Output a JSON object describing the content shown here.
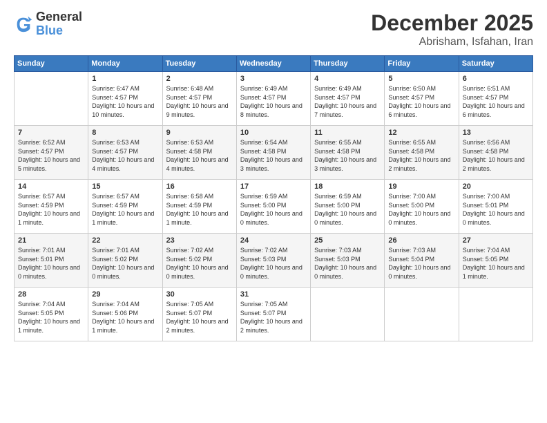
{
  "logo": {
    "line1": "General",
    "line2": "Blue"
  },
  "header": {
    "month": "December 2025",
    "location": "Abrisham, Isfahan, Iran"
  },
  "weekdays": [
    "Sunday",
    "Monday",
    "Tuesday",
    "Wednesday",
    "Thursday",
    "Friday",
    "Saturday"
  ],
  "weeks": [
    [
      {
        "day": "",
        "sunrise": "",
        "sunset": "",
        "daylight": ""
      },
      {
        "day": "1",
        "sunrise": "Sunrise: 6:47 AM",
        "sunset": "Sunset: 4:57 PM",
        "daylight": "Daylight: 10 hours and 10 minutes."
      },
      {
        "day": "2",
        "sunrise": "Sunrise: 6:48 AM",
        "sunset": "Sunset: 4:57 PM",
        "daylight": "Daylight: 10 hours and 9 minutes."
      },
      {
        "day": "3",
        "sunrise": "Sunrise: 6:49 AM",
        "sunset": "Sunset: 4:57 PM",
        "daylight": "Daylight: 10 hours and 8 minutes."
      },
      {
        "day": "4",
        "sunrise": "Sunrise: 6:49 AM",
        "sunset": "Sunset: 4:57 PM",
        "daylight": "Daylight: 10 hours and 7 minutes."
      },
      {
        "day": "5",
        "sunrise": "Sunrise: 6:50 AM",
        "sunset": "Sunset: 4:57 PM",
        "daylight": "Daylight: 10 hours and 6 minutes."
      },
      {
        "day": "6",
        "sunrise": "Sunrise: 6:51 AM",
        "sunset": "Sunset: 4:57 PM",
        "daylight": "Daylight: 10 hours and 6 minutes."
      }
    ],
    [
      {
        "day": "7",
        "sunrise": "Sunrise: 6:52 AM",
        "sunset": "Sunset: 4:57 PM",
        "daylight": "Daylight: 10 hours and 5 minutes."
      },
      {
        "day": "8",
        "sunrise": "Sunrise: 6:53 AM",
        "sunset": "Sunset: 4:57 PM",
        "daylight": "Daylight: 10 hours and 4 minutes."
      },
      {
        "day": "9",
        "sunrise": "Sunrise: 6:53 AM",
        "sunset": "Sunset: 4:58 PM",
        "daylight": "Daylight: 10 hours and 4 minutes."
      },
      {
        "day": "10",
        "sunrise": "Sunrise: 6:54 AM",
        "sunset": "Sunset: 4:58 PM",
        "daylight": "Daylight: 10 hours and 3 minutes."
      },
      {
        "day": "11",
        "sunrise": "Sunrise: 6:55 AM",
        "sunset": "Sunset: 4:58 PM",
        "daylight": "Daylight: 10 hours and 3 minutes."
      },
      {
        "day": "12",
        "sunrise": "Sunrise: 6:55 AM",
        "sunset": "Sunset: 4:58 PM",
        "daylight": "Daylight: 10 hours and 2 minutes."
      },
      {
        "day": "13",
        "sunrise": "Sunrise: 6:56 AM",
        "sunset": "Sunset: 4:58 PM",
        "daylight": "Daylight: 10 hours and 2 minutes."
      }
    ],
    [
      {
        "day": "14",
        "sunrise": "Sunrise: 6:57 AM",
        "sunset": "Sunset: 4:59 PM",
        "daylight": "Daylight: 10 hours and 1 minute."
      },
      {
        "day": "15",
        "sunrise": "Sunrise: 6:57 AM",
        "sunset": "Sunset: 4:59 PM",
        "daylight": "Daylight: 10 hours and 1 minute."
      },
      {
        "day": "16",
        "sunrise": "Sunrise: 6:58 AM",
        "sunset": "Sunset: 4:59 PM",
        "daylight": "Daylight: 10 hours and 1 minute."
      },
      {
        "day": "17",
        "sunrise": "Sunrise: 6:59 AM",
        "sunset": "Sunset: 5:00 PM",
        "daylight": "Daylight: 10 hours and 0 minutes."
      },
      {
        "day": "18",
        "sunrise": "Sunrise: 6:59 AM",
        "sunset": "Sunset: 5:00 PM",
        "daylight": "Daylight: 10 hours and 0 minutes."
      },
      {
        "day": "19",
        "sunrise": "Sunrise: 7:00 AM",
        "sunset": "Sunset: 5:00 PM",
        "daylight": "Daylight: 10 hours and 0 minutes."
      },
      {
        "day": "20",
        "sunrise": "Sunrise: 7:00 AM",
        "sunset": "Sunset: 5:01 PM",
        "daylight": "Daylight: 10 hours and 0 minutes."
      }
    ],
    [
      {
        "day": "21",
        "sunrise": "Sunrise: 7:01 AM",
        "sunset": "Sunset: 5:01 PM",
        "daylight": "Daylight: 10 hours and 0 minutes."
      },
      {
        "day": "22",
        "sunrise": "Sunrise: 7:01 AM",
        "sunset": "Sunset: 5:02 PM",
        "daylight": "Daylight: 10 hours and 0 minutes."
      },
      {
        "day": "23",
        "sunrise": "Sunrise: 7:02 AM",
        "sunset": "Sunset: 5:02 PM",
        "daylight": "Daylight: 10 hours and 0 minutes."
      },
      {
        "day": "24",
        "sunrise": "Sunrise: 7:02 AM",
        "sunset": "Sunset: 5:03 PM",
        "daylight": "Daylight: 10 hours and 0 minutes."
      },
      {
        "day": "25",
        "sunrise": "Sunrise: 7:03 AM",
        "sunset": "Sunset: 5:03 PM",
        "daylight": "Daylight: 10 hours and 0 minutes."
      },
      {
        "day": "26",
        "sunrise": "Sunrise: 7:03 AM",
        "sunset": "Sunset: 5:04 PM",
        "daylight": "Daylight: 10 hours and 0 minutes."
      },
      {
        "day": "27",
        "sunrise": "Sunrise: 7:04 AM",
        "sunset": "Sunset: 5:05 PM",
        "daylight": "Daylight: 10 hours and 1 minute."
      }
    ],
    [
      {
        "day": "28",
        "sunrise": "Sunrise: 7:04 AM",
        "sunset": "Sunset: 5:05 PM",
        "daylight": "Daylight: 10 hours and 1 minute."
      },
      {
        "day": "29",
        "sunrise": "Sunrise: 7:04 AM",
        "sunset": "Sunset: 5:06 PM",
        "daylight": "Daylight: 10 hours and 1 minute."
      },
      {
        "day": "30",
        "sunrise": "Sunrise: 7:05 AM",
        "sunset": "Sunset: 5:07 PM",
        "daylight": "Daylight: 10 hours and 2 minutes."
      },
      {
        "day": "31",
        "sunrise": "Sunrise: 7:05 AM",
        "sunset": "Sunset: 5:07 PM",
        "daylight": "Daylight: 10 hours and 2 minutes."
      },
      {
        "day": "",
        "sunrise": "",
        "sunset": "",
        "daylight": ""
      },
      {
        "day": "",
        "sunrise": "",
        "sunset": "",
        "daylight": ""
      },
      {
        "day": "",
        "sunrise": "",
        "sunset": "",
        "daylight": ""
      }
    ]
  ]
}
